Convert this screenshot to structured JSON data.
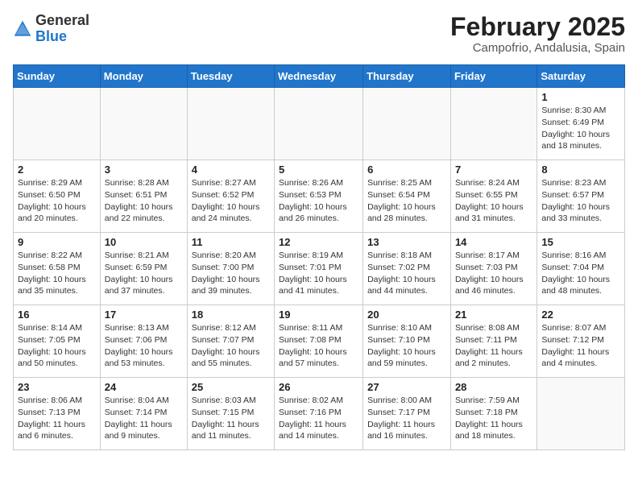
{
  "header": {
    "logo_general": "General",
    "logo_blue": "Blue",
    "title": "February 2025",
    "subtitle": "Campofrio, Andalusia, Spain"
  },
  "days_of_week": [
    "Sunday",
    "Monday",
    "Tuesday",
    "Wednesday",
    "Thursday",
    "Friday",
    "Saturday"
  ],
  "weeks": [
    [
      {
        "day": "",
        "info": ""
      },
      {
        "day": "",
        "info": ""
      },
      {
        "day": "",
        "info": ""
      },
      {
        "day": "",
        "info": ""
      },
      {
        "day": "",
        "info": ""
      },
      {
        "day": "",
        "info": ""
      },
      {
        "day": "1",
        "info": "Sunrise: 8:30 AM\nSunset: 6:49 PM\nDaylight: 10 hours\nand 18 minutes."
      }
    ],
    [
      {
        "day": "2",
        "info": "Sunrise: 8:29 AM\nSunset: 6:50 PM\nDaylight: 10 hours\nand 20 minutes."
      },
      {
        "day": "3",
        "info": "Sunrise: 8:28 AM\nSunset: 6:51 PM\nDaylight: 10 hours\nand 22 minutes."
      },
      {
        "day": "4",
        "info": "Sunrise: 8:27 AM\nSunset: 6:52 PM\nDaylight: 10 hours\nand 24 minutes."
      },
      {
        "day": "5",
        "info": "Sunrise: 8:26 AM\nSunset: 6:53 PM\nDaylight: 10 hours\nand 26 minutes."
      },
      {
        "day": "6",
        "info": "Sunrise: 8:25 AM\nSunset: 6:54 PM\nDaylight: 10 hours\nand 28 minutes."
      },
      {
        "day": "7",
        "info": "Sunrise: 8:24 AM\nSunset: 6:55 PM\nDaylight: 10 hours\nand 31 minutes."
      },
      {
        "day": "8",
        "info": "Sunrise: 8:23 AM\nSunset: 6:57 PM\nDaylight: 10 hours\nand 33 minutes."
      }
    ],
    [
      {
        "day": "9",
        "info": "Sunrise: 8:22 AM\nSunset: 6:58 PM\nDaylight: 10 hours\nand 35 minutes."
      },
      {
        "day": "10",
        "info": "Sunrise: 8:21 AM\nSunset: 6:59 PM\nDaylight: 10 hours\nand 37 minutes."
      },
      {
        "day": "11",
        "info": "Sunrise: 8:20 AM\nSunset: 7:00 PM\nDaylight: 10 hours\nand 39 minutes."
      },
      {
        "day": "12",
        "info": "Sunrise: 8:19 AM\nSunset: 7:01 PM\nDaylight: 10 hours\nand 41 minutes."
      },
      {
        "day": "13",
        "info": "Sunrise: 8:18 AM\nSunset: 7:02 PM\nDaylight: 10 hours\nand 44 minutes."
      },
      {
        "day": "14",
        "info": "Sunrise: 8:17 AM\nSunset: 7:03 PM\nDaylight: 10 hours\nand 46 minutes."
      },
      {
        "day": "15",
        "info": "Sunrise: 8:16 AM\nSunset: 7:04 PM\nDaylight: 10 hours\nand 48 minutes."
      }
    ],
    [
      {
        "day": "16",
        "info": "Sunrise: 8:14 AM\nSunset: 7:05 PM\nDaylight: 10 hours\nand 50 minutes."
      },
      {
        "day": "17",
        "info": "Sunrise: 8:13 AM\nSunset: 7:06 PM\nDaylight: 10 hours\nand 53 minutes."
      },
      {
        "day": "18",
        "info": "Sunrise: 8:12 AM\nSunset: 7:07 PM\nDaylight: 10 hours\nand 55 minutes."
      },
      {
        "day": "19",
        "info": "Sunrise: 8:11 AM\nSunset: 7:08 PM\nDaylight: 10 hours\nand 57 minutes."
      },
      {
        "day": "20",
        "info": "Sunrise: 8:10 AM\nSunset: 7:10 PM\nDaylight: 10 hours\nand 59 minutes."
      },
      {
        "day": "21",
        "info": "Sunrise: 8:08 AM\nSunset: 7:11 PM\nDaylight: 11 hours\nand 2 minutes."
      },
      {
        "day": "22",
        "info": "Sunrise: 8:07 AM\nSunset: 7:12 PM\nDaylight: 11 hours\nand 4 minutes."
      }
    ],
    [
      {
        "day": "23",
        "info": "Sunrise: 8:06 AM\nSunset: 7:13 PM\nDaylight: 11 hours\nand 6 minutes."
      },
      {
        "day": "24",
        "info": "Sunrise: 8:04 AM\nSunset: 7:14 PM\nDaylight: 11 hours\nand 9 minutes."
      },
      {
        "day": "25",
        "info": "Sunrise: 8:03 AM\nSunset: 7:15 PM\nDaylight: 11 hours\nand 11 minutes."
      },
      {
        "day": "26",
        "info": "Sunrise: 8:02 AM\nSunset: 7:16 PM\nDaylight: 11 hours\nand 14 minutes."
      },
      {
        "day": "27",
        "info": "Sunrise: 8:00 AM\nSunset: 7:17 PM\nDaylight: 11 hours\nand 16 minutes."
      },
      {
        "day": "28",
        "info": "Sunrise: 7:59 AM\nSunset: 7:18 PM\nDaylight: 11 hours\nand 18 minutes."
      },
      {
        "day": "",
        "info": ""
      }
    ]
  ]
}
